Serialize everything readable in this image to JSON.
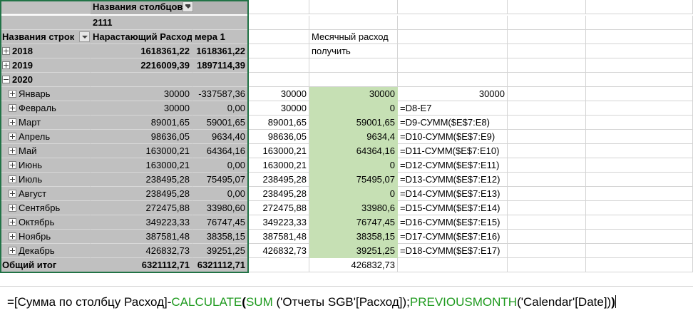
{
  "pivot": {
    "col_fields_label": "Названия столбцов",
    "col_value": "2111",
    "row_labels_header": "Названия строк",
    "col1_header": "Нарастающий Расход",
    "col2_header": "мера 1",
    "years": [
      {
        "label": "2018",
        "v1": "1618361,22",
        "v2": "1618361,22"
      },
      {
        "label": "2019",
        "v1": "2216009,39",
        "v2": "1897114,39"
      }
    ],
    "year_2020": "2020",
    "months": [
      {
        "label": "Январь",
        "v1": "30000",
        "v2": "-337587,36",
        "d": "30000",
        "e": "30000",
        "f": "30000"
      },
      {
        "label": "Февраль",
        "v1": "30000",
        "v2": "0,00",
        "d": "30000",
        "e": "0",
        "f": "=D8-E7"
      },
      {
        "label": "Март",
        "v1": "89001,65",
        "v2": "59001,65",
        "d": "89001,65",
        "e": "59001,65",
        "f": "=D9-СУММ($E$7:E8)"
      },
      {
        "label": "Апрель",
        "v1": "98636,05",
        "v2": "9634,40",
        "d": "98636,05",
        "e": "9634,4",
        "f": "=D10-СУММ($E$7:E9)"
      },
      {
        "label": "Май",
        "v1": "163000,21",
        "v2": "64364,16",
        "d": "163000,21",
        "e": "64364,16",
        "f": "=D11-СУММ($E$7:E10)"
      },
      {
        "label": "Июнь",
        "v1": "163000,21",
        "v2": "0,00",
        "d": "163000,21",
        "e": "0",
        "f": "=D12-СУММ($E$7:E11)"
      },
      {
        "label": "Июль",
        "v1": "238495,28",
        "v2": "75495,07",
        "d": "238495,28",
        "e": "75495,07",
        "f": "=D13-СУММ($E$7:E12)"
      },
      {
        "label": "Август",
        "v1": "238495,28",
        "v2": "0,00",
        "d": "238495,28",
        "e": "0",
        "f": "=D14-СУММ($E$7:E13)"
      },
      {
        "label": "Сентябрь",
        "v1": "272475,88",
        "v2": "33980,60",
        "d": "272475,88",
        "e": "33980,6",
        "f": "=D15-СУММ($E$7:E14)"
      },
      {
        "label": "Октябрь",
        "v1": "349223,33",
        "v2": "76747,45",
        "d": "349223,33",
        "e": "76747,45",
        "f": "=D16-СУММ($E$7:E15)"
      },
      {
        "label": "Ноябрь",
        "v1": "387581,48",
        "v2": "38358,15",
        "d": "387581,48",
        "e": "38358,15",
        "f": "=D17-СУММ($E$7:E16)"
      },
      {
        "label": "Декабрь",
        "v1": "426832,73",
        "v2": "39251,25",
        "d": "426832,73",
        "e": "39251,25",
        "f": "=D18-СУММ($E$7:E17)"
      }
    ],
    "grand_total_label": "Общий итог",
    "grand_total_v1": "6321112,71",
    "grand_total_v2": "6321112,71"
  },
  "side": {
    "note_line1": "Месячный расход",
    "note_line2": "получить",
    "total_e": "426832,73"
  },
  "formula_bar": {
    "part1": "=[Сумма по столбцу Расход]-",
    "fn_calculate": "CALCULATE",
    "paren_open": "(",
    "fn_sum": "SUM",
    "part2": " ('Отчеты SGB'[Расход]);",
    "fn_prev": "PREVIOUSMONTH",
    "part3": "('Calendar'[Date])",
    "paren_close": ")"
  },
  "colors": {
    "pivot_bg": "#c0c0c0",
    "highlight_green": "#c6e0b4",
    "selection_border": "#217346",
    "dax_function": "#1e9a1e"
  }
}
